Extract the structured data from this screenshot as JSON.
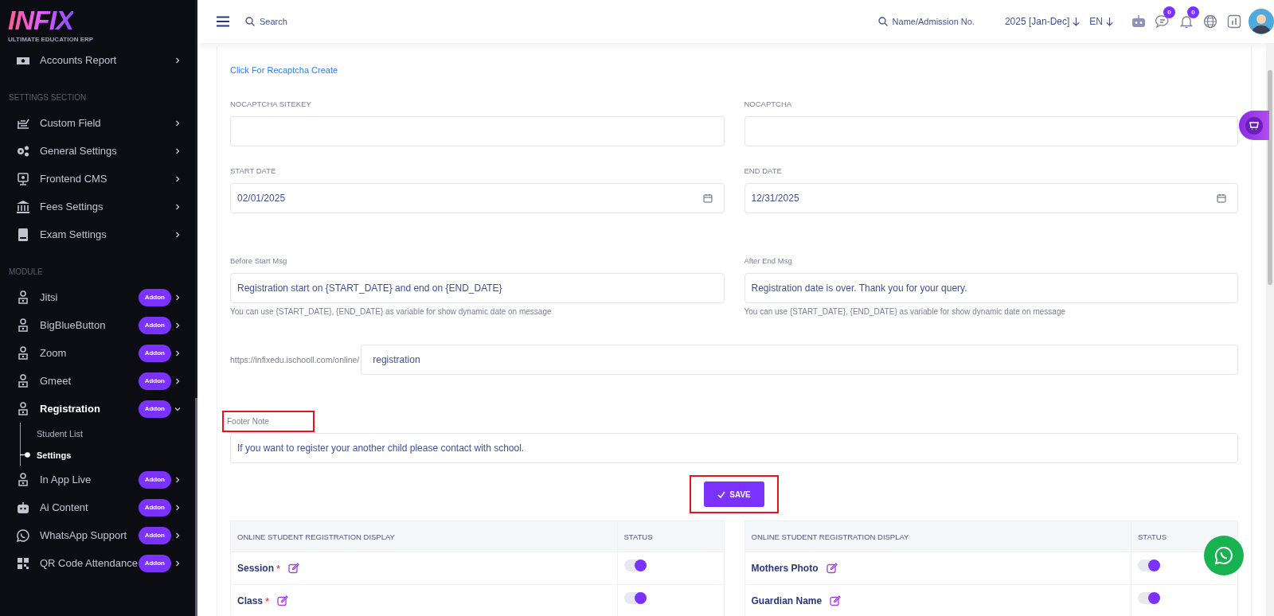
{
  "sidebar": {
    "logo": {
      "title": "INFIX",
      "subtitle": "ULTIMATE EDUCATION ERP"
    },
    "sections": [
      {
        "items": [
          {
            "label": "Accounts Report",
            "kind": "money",
            "selected": false,
            "expanded": false
          }
        ]
      },
      {
        "heading": "SETTINGS SECTION",
        "items": [
          {
            "label": "Custom Field",
            "kind": "fields",
            "selected": false,
            "expanded": false
          },
          {
            "label": "General Settings",
            "kind": "gears",
            "selected": false,
            "expanded": false
          },
          {
            "label": "Frontend CMS",
            "kind": "monitor",
            "selected": false,
            "expanded": false
          },
          {
            "label": "Fees Settings",
            "kind": "bank",
            "selected": false,
            "expanded": false
          },
          {
            "label": "Exam Settings",
            "kind": "book",
            "selected": false,
            "expanded": false
          }
        ]
      },
      {
        "heading": "MODULE",
        "items": [
          {
            "label": "Jitsi",
            "kind": "person",
            "badge": "Addon",
            "selected": false,
            "expanded": false
          },
          {
            "label": "BigBlueButton",
            "kind": "person",
            "badge": "Addon",
            "selected": false,
            "expanded": false
          },
          {
            "label": "Zoom",
            "kind": "person",
            "badge": "Addon",
            "selected": false,
            "expanded": false
          },
          {
            "label": "Gmeet",
            "kind": "person",
            "badge": "Addon",
            "selected": false,
            "expanded": false
          },
          {
            "label": "Registration",
            "kind": "person",
            "badge": "Addon",
            "selected": true,
            "expanded": true,
            "children": [
              {
                "label": "Student List",
                "selected": false
              },
              {
                "label": "Settings",
                "selected": true
              }
            ]
          },
          {
            "label": "In App Live",
            "kind": "person",
            "badge": "Addon",
            "selected": false,
            "expanded": false
          },
          {
            "label": "Ai Content",
            "kind": "robot",
            "badge": "Addon",
            "selected": false,
            "expanded": false
          },
          {
            "label": "WhatsApp Support",
            "kind": "whatsapp",
            "badge": "Addon",
            "selected": false,
            "expanded": false
          },
          {
            "label": "QR Code Attendance",
            "kind": "qr",
            "badge": "Addon",
            "selected": false,
            "expanded": false
          }
        ]
      }
    ]
  },
  "header": {
    "search": {
      "placeholder": "Search"
    },
    "student_search": {
      "placeholder": "Name/Admission No."
    },
    "session": "2025 [Jan-Dec]",
    "language": "EN",
    "chat_count": "0",
    "notification_count": "0"
  },
  "form": {
    "recaptcha_link": "Click For Recaptcha Create",
    "rows": [
      [
        {
          "label": "NOCAPTCHA SITEKEY",
          "kind": "text"
        },
        {
          "label": "NOCAPTCHA",
          "kind": "text"
        }
      ],
      [
        {
          "label": "START DATE",
          "kind": "date",
          "value": "02/01/2025"
        },
        {
          "label": "END DATE",
          "kind": "date",
          "value": "12/31/2025"
        }
      ],
      [
        {
          "label": "Before Start Msg",
          "kind": "text",
          "value": "Registration start on {START_DATE} and end on {END_DATE}",
          "hint": "You can use {START_DATE}, {END_DATE} as variable for show dynamic date on message"
        },
        {
          "label": "After End Msg",
          "kind": "text",
          "value": "Registration date is over. Thank you for your query.",
          "hint": "You can use {START_DATE}, {END_DATE} as variable for show dynamic date on message"
        }
      ]
    ],
    "url": {
      "prefix": "https://infixedu.ischooll.com/online/",
      "value": "registration"
    },
    "footer_note": {
      "label": "Footer Note",
      "highlighted": true,
      "value": "If you want to register your another child please contact with school."
    },
    "save_button": {
      "label": "SAVE",
      "highlighted": true
    },
    "tables": [
      {
        "columns": [
          "ONLINE STUDENT REGISTRATION DISPLAY",
          "STATUS"
        ],
        "rows": [
          {
            "label": "Session",
            "required_mark": "*",
            "on": true
          },
          {
            "label": "Class",
            "required_mark": "*",
            "on": true
          }
        ]
      },
      {
        "columns": [
          "ONLINE STUDENT REGISTRATION DISPLAY",
          "STATUS"
        ],
        "rows": [
          {
            "label": "Mothers Photo",
            "on": true
          },
          {
            "label": "Guardian Name",
            "on": true
          }
        ]
      }
    ]
  }
}
